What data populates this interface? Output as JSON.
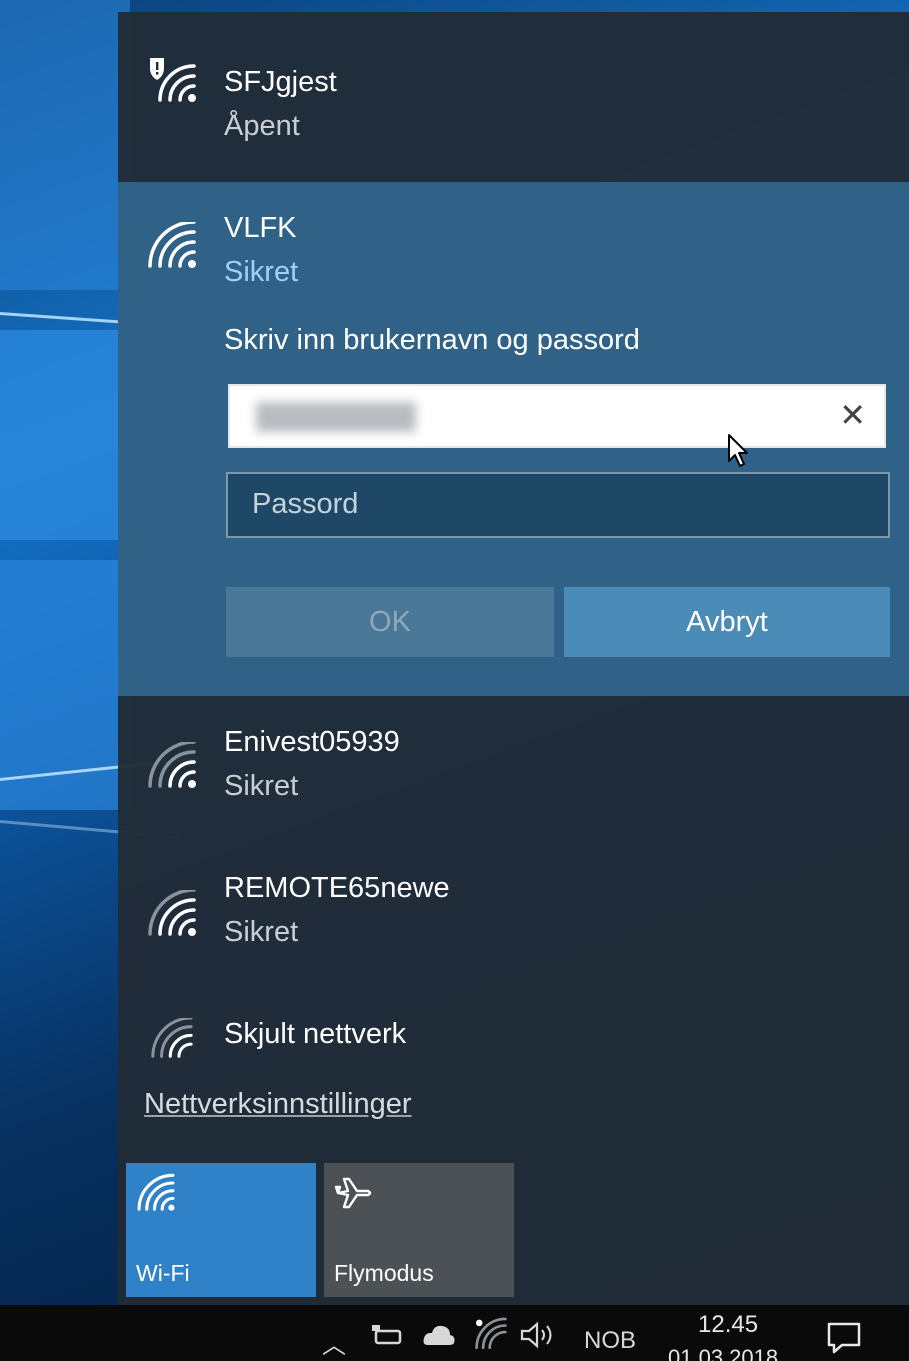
{
  "networks": [
    {
      "name": "SFJgjest",
      "status": "Åpent",
      "icon": "wifi-shield-icon"
    },
    {
      "name": "VLFK",
      "status": "Sikret",
      "icon": "wifi-icon",
      "expanded": true
    },
    {
      "name": "Enivest05939",
      "status": "Sikret",
      "icon": "wifi-icon"
    },
    {
      "name": "REMOTE65newe",
      "status": "Sikret",
      "icon": "wifi-icon"
    },
    {
      "name": "Skjult nettverk",
      "status": "",
      "icon": "wifi-weak-icon"
    }
  ],
  "connect_form": {
    "prompt": "Skriv inn brukernavn og passord",
    "password_placeholder": "Passord",
    "clear_glyph": "✕",
    "ok_label": "OK",
    "cancel_label": "Avbryt"
  },
  "settings_link": "Nettverksinnstillinger",
  "quick_actions": [
    {
      "label": "Wi-Fi",
      "active": true,
      "icon": "wifi-icon"
    },
    {
      "label": "Flymodus",
      "active": false,
      "icon": "airplane-icon"
    }
  ],
  "taskbar": {
    "language": "NOB",
    "time": "12.45",
    "date": "01.03.2018"
  },
  "colors": {
    "panel_bg": "#212c37",
    "expanded_bg": "#2f6286",
    "accent": "#2f82c8",
    "secured_text": "#9fd0ff"
  }
}
